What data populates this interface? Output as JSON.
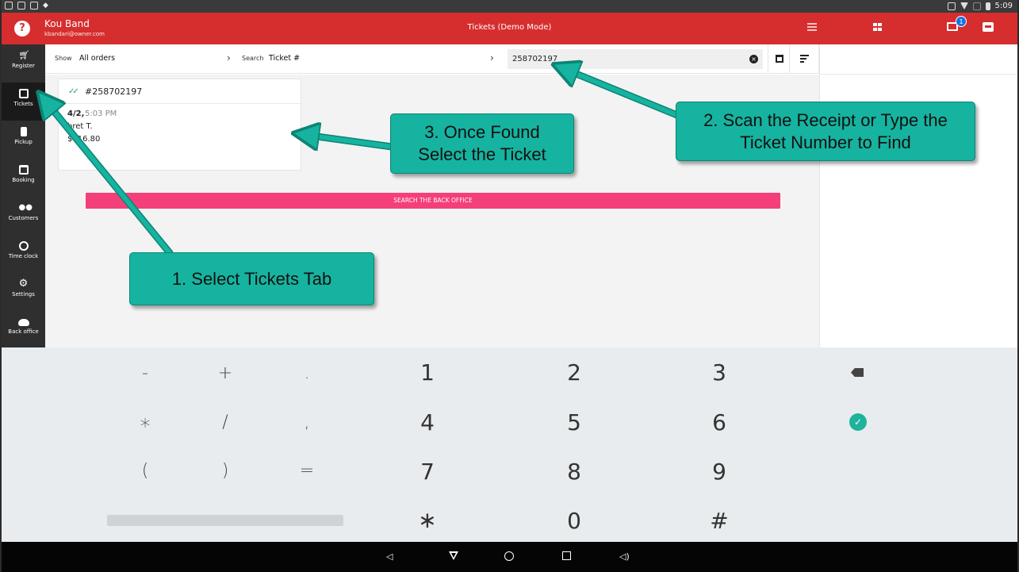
{
  "status_bar": {
    "time": "5:09"
  },
  "app_bar": {
    "help_label": "?",
    "user_name": "Kou Band",
    "user_email": "kbandari@owner.com",
    "title": "Tickets  (Demo Mode)",
    "devices_badge": "1"
  },
  "sidebar": {
    "items": [
      {
        "label": "Register",
        "icon": "cart-icon"
      },
      {
        "label": "Tickets",
        "icon": "receipt-icon",
        "active": true
      },
      {
        "label": "Pickup",
        "icon": "traffic-light-icon"
      },
      {
        "label": "Booking",
        "icon": "calendar-icon"
      },
      {
        "label": "Customers",
        "icon": "people-icon"
      },
      {
        "label": "Time clock",
        "icon": "clock-icon"
      },
      {
        "label": "Settings",
        "icon": "gear-icon"
      },
      {
        "label": "Back office",
        "icon": "cloud-icon"
      }
    ]
  },
  "filter_bar": {
    "show_label": "Show",
    "show_value": "All orders",
    "search_label": "Search",
    "search_field": "Ticket #",
    "search_value": "258702197"
  },
  "ticket": {
    "number": "#258702197",
    "date": "4/2,",
    "time": "5:03 PM",
    "customer": "bret T.",
    "total": "$116.80"
  },
  "search_backoffice_label": "SEARCH THE BACK OFFICE",
  "keyboard": {
    "rows": [
      [
        "-",
        "+",
        ".",
        "1",
        "2",
        "3"
      ],
      [
        "∗",
        "/",
        ",",
        "4",
        "5",
        "6"
      ],
      [
        "(",
        ")",
        "=",
        "7",
        "8",
        "9"
      ],
      [
        "",
        "",
        "",
        "∗",
        "0",
        "#"
      ]
    ],
    "done_label": "✓"
  },
  "callouts": {
    "step1": "1. Select Tickets Tab",
    "step2": "2. Scan the Receipt or Type the Ticket Number to Find",
    "step3": "3. Once Found Select the Ticket"
  },
  "colors": {
    "app_bar": "#d62e2e",
    "sidebar": "#2f2f2f",
    "callout": "#16b3a0",
    "backoffice_button": "#f43f7a",
    "accent_check": "#1f9d87"
  }
}
